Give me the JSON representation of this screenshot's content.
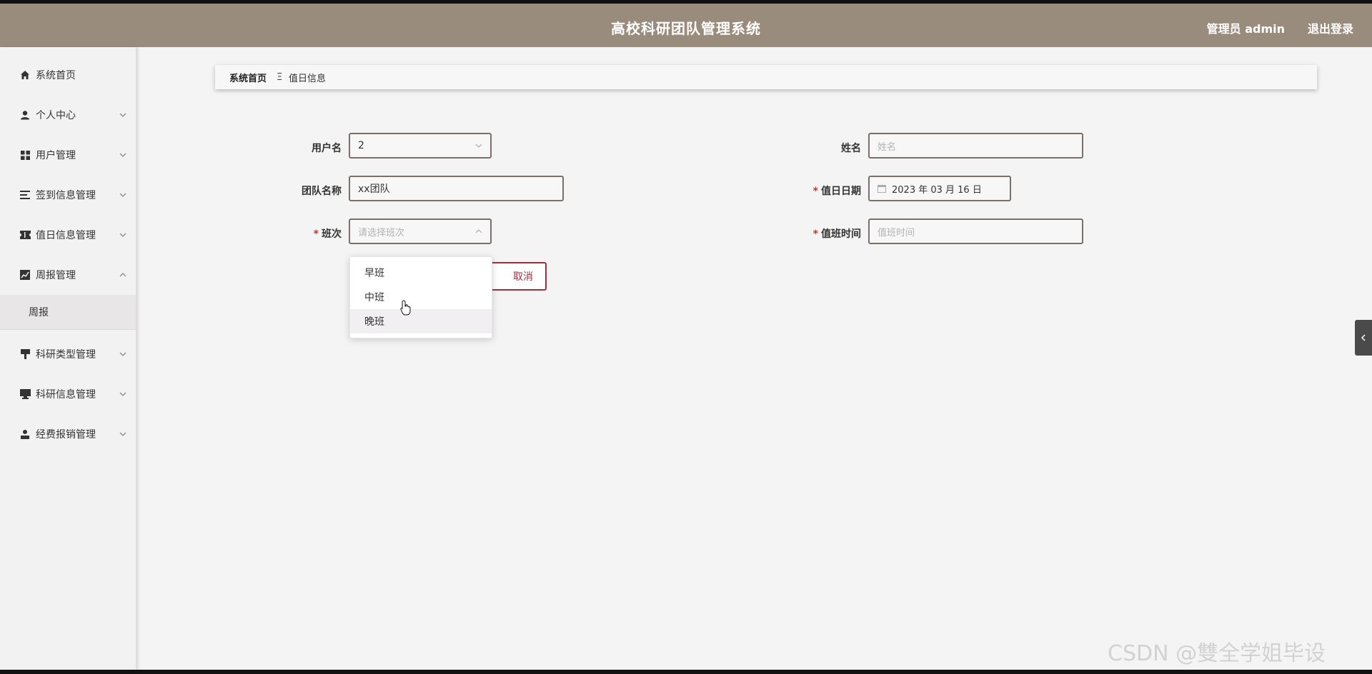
{
  "header": {
    "title": "高校科研团队管理系统",
    "user": "管理员 admin",
    "logout": "退出登录",
    "bg_color": "#9a8c7d"
  },
  "sidebar": {
    "items": [
      {
        "label": "系统首页",
        "icon": "home-icon"
      },
      {
        "label": "个人中心",
        "icon": "user-icon"
      },
      {
        "label": "用户管理",
        "icon": "grid-icon"
      },
      {
        "label": "签到信息管理",
        "icon": "list-icon"
      },
      {
        "label": "值日信息管理",
        "icon": "ticket-icon"
      },
      {
        "label": "周报管理",
        "icon": "chart-icon"
      },
      {
        "label": "科研类型管理",
        "icon": "flag-icon"
      },
      {
        "label": "科研信息管理",
        "icon": "monitor-icon"
      },
      {
        "label": "经费报销管理",
        "icon": "person-icon"
      }
    ],
    "sub_item": "周报"
  },
  "breadcrumb": {
    "home": "系统首页",
    "sep": "Ξ",
    "current": "值日信息"
  },
  "form": {
    "username_label": "用户名",
    "username_value": "2",
    "name_label": "姓名",
    "name_placeholder": "姓名",
    "team_label": "团队名称",
    "team_value": "xx团队",
    "date_label": "值日日期",
    "date_value": "2023 年 03 月 16 日",
    "shift_label": "班次",
    "shift_placeholder": "请选择班次",
    "time_label": "值班时间",
    "time_placeholder": "值班时间",
    "required_mark": "*",
    "shift_options": [
      "早班",
      "中班",
      "晚班"
    ],
    "cancel_label": "取消",
    "accent_color": "#a32d3d"
  },
  "watermark": "CSDN @雙全学姐毕设"
}
